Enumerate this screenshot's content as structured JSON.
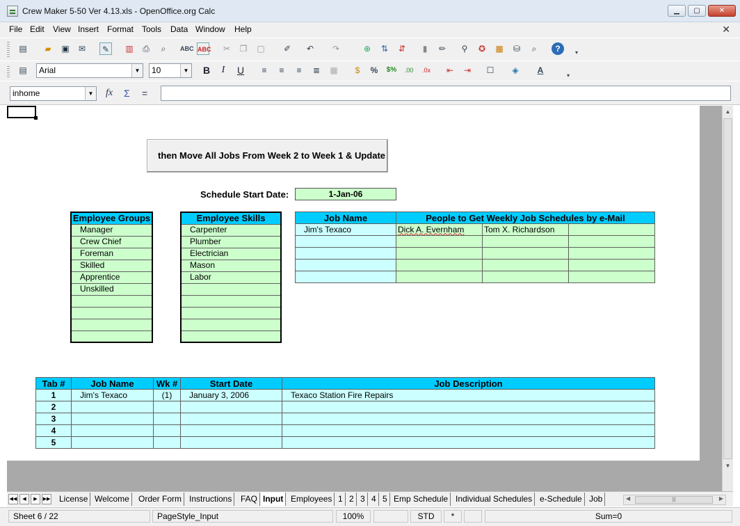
{
  "window": {
    "title": "Crew Maker 5-50 Ver 4.13.xls - OpenOffice.org Calc",
    "minimize": "▁",
    "maximize": "▢",
    "close": "✕"
  },
  "menu": [
    "File",
    "Edit",
    "View",
    "Insert",
    "Format",
    "Tools",
    "Data",
    "Window",
    "Help"
  ],
  "document_close": "✕",
  "toolbar": {
    "font_name": "Arial",
    "font_size": "10",
    "bold": "B",
    "italic": "I",
    "underline": "U",
    "percent": "%",
    "help": "?"
  },
  "formula_bar": {
    "name_box": "inhome",
    "function_wizard": "fx",
    "sum": "Σ",
    "equals": "=",
    "input": ""
  },
  "sheet": {
    "macro_button": "then Move All Jobs From Week 2 to Week 1 & Update",
    "schedule_label": "Schedule Start Date:",
    "schedule_value": "1-Jan-06",
    "groups_header": "Employee Groups",
    "groups": [
      "Manager",
      "Crew Chief",
      "Foreman",
      "Skilled",
      "Apprentice",
      "Unskilled",
      "",
      "",
      "",
      ""
    ],
    "skills_header": "Employee Skills",
    "skills": [
      "Carpenter",
      "Plumber",
      "Electrician",
      "Mason",
      "Labor",
      "",
      "",
      "",
      "",
      ""
    ],
    "email_table": {
      "headers": [
        "Job Name",
        "People to Get Weekly Job Schedules by e-Mail"
      ],
      "rows": [
        [
          "Jim's Texaco",
          "Dick A. Evernham",
          "Tom X. Richardson",
          ""
        ],
        [
          "",
          "",
          "",
          ""
        ],
        [
          "",
          "",
          "",
          ""
        ],
        [
          "",
          "",
          "",
          ""
        ],
        [
          "",
          "",
          "",
          ""
        ]
      ]
    },
    "jobs_table": {
      "headers": [
        "Tab #",
        "Job Name",
        "Wk #",
        "Start Date",
        "Job Description"
      ],
      "rows": [
        [
          "1",
          "Jim's Texaco",
          "(1)",
          "January 3, 2006",
          "Texaco Station Fire Repairs"
        ],
        [
          "2",
          "",
          "",
          "",
          ""
        ],
        [
          "3",
          "",
          "",
          "",
          ""
        ],
        [
          "4",
          "",
          "",
          "",
          ""
        ],
        [
          "5",
          "",
          "",
          "",
          ""
        ]
      ]
    }
  },
  "tabs": [
    "License",
    "Welcome",
    "Order Form",
    "Instructions",
    "FAQ",
    "Input",
    "Employees",
    "1",
    "2",
    "3",
    "4",
    "5",
    "Emp Schedule",
    "Individual Schedules",
    "e-Schedule",
    "Job"
  ],
  "active_tab": "Input",
  "status": {
    "sheet": "Sheet 6 / 22",
    "page_style": "PageStyle_Input",
    "zoom": "100%",
    "mode": "STD",
    "modified": "*",
    "sum": "Sum=0"
  }
}
